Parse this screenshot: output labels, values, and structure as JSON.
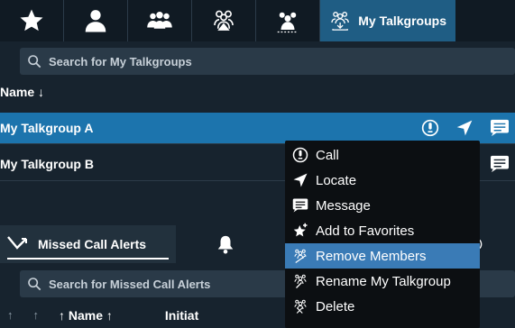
{
  "tabs": {
    "active_label": "My Talkgroups",
    "icons": [
      "star-icon",
      "person-icon",
      "group-icon",
      "broadcast-group-icon",
      "talkgroup-icon",
      "my-talkgroups-icon"
    ]
  },
  "search": {
    "placeholder": "Search for My Talkgroups"
  },
  "list": {
    "column_header": "Name ↓",
    "rows": [
      {
        "name": "My Talkgroup A",
        "selected": true
      },
      {
        "name": "My Talkgroup B",
        "selected": false
      }
    ]
  },
  "lower_tabs": {
    "missed_calls_label": "Missed Call Alerts"
  },
  "lower_search": {
    "placeholder": "Search for Missed Call Alerts"
  },
  "lower_list": {
    "arrow1": "↑",
    "arrow2": "↑",
    "name_header": "↑ Name ↑",
    "initiator_header": "Initiat"
  },
  "context_menu": {
    "items": [
      {
        "label": "Call",
        "icon": "call-icon"
      },
      {
        "label": "Locate",
        "icon": "locate-icon"
      },
      {
        "label": "Message",
        "icon": "message-icon"
      },
      {
        "label": "Add to Favorites",
        "icon": "add-favorite-icon"
      },
      {
        "label": "Remove Members",
        "icon": "remove-members-icon",
        "highlighted": true
      },
      {
        "label": "Rename My Talkgroup",
        "icon": "rename-icon"
      },
      {
        "label": "Delete",
        "icon": "delete-icon"
      }
    ]
  },
  "colors": {
    "background": "#17232e",
    "selected_row": "#1c74ad",
    "menu_bg": "#0c0f12",
    "menu_highlight": "#3a7bb6"
  }
}
